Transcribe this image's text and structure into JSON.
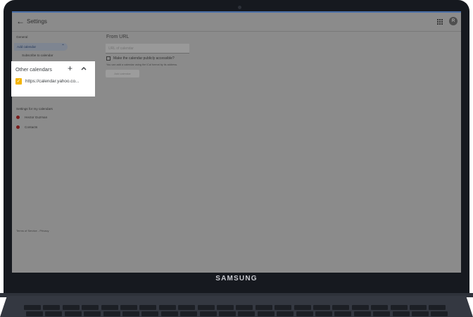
{
  "header": {
    "back_glyph": "←",
    "title": "Settings",
    "avatar_initial": "R"
  },
  "sidebar": {
    "section_general": "General",
    "add_calendar": "Add calendar",
    "add_calendar_chevron": "⌃",
    "subscribe": "Subscribe to calendar",
    "other_calendars": {
      "title": "Other calendars",
      "add_glyph": "+",
      "item_check": "✓",
      "item_label": "https://calendar.yahoo.co..."
    },
    "section_my_calendars": "Settings for my calendars",
    "my_calendars": [
      {
        "label": "Hector Guzman"
      },
      {
        "label": "Contacts"
      }
    ],
    "footer": "Terms of Service - Privacy"
  },
  "main": {
    "heading": "From URL",
    "url_placeholder": "URL of calendar",
    "public_label": "Make the calendar publicly accessible?",
    "hint": "You can add a calendar using the iCal format by its address.",
    "add_button": "Add calendar"
  },
  "device": {
    "brand": "SAMSUNG"
  },
  "colors": {
    "accent": "#f4b400",
    "overlay": "#8b8b8b",
    "bezel": "#16191f",
    "calendar_dot": "#7a1d1d"
  }
}
